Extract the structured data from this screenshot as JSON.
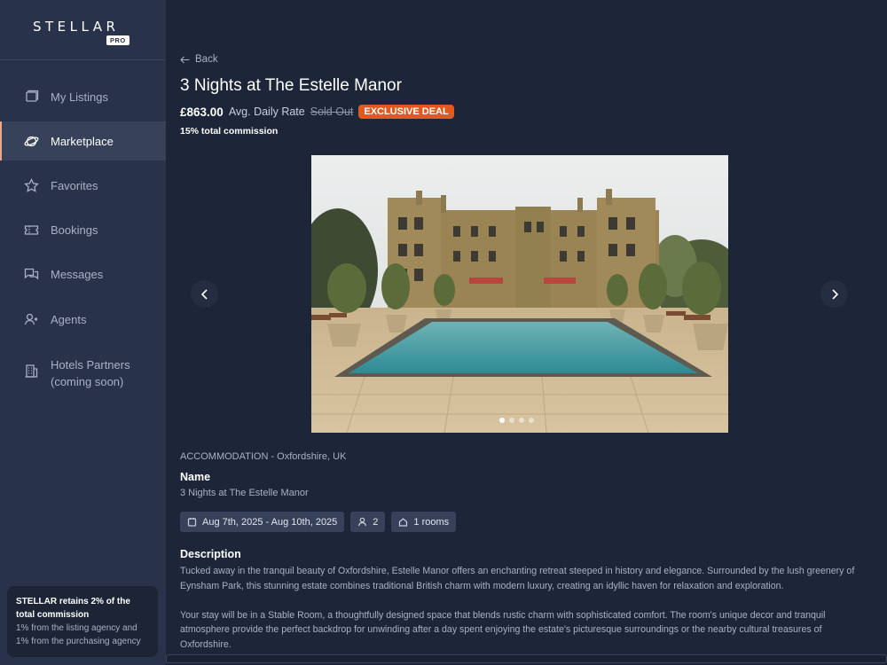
{
  "brand": {
    "name": "STELLAR",
    "badge": "PRO"
  },
  "sidebar": {
    "items": [
      {
        "label": "My Listings",
        "icon": "listings-icon"
      },
      {
        "label": "Marketplace",
        "icon": "planet-icon",
        "active": true
      },
      {
        "label": "Favorites",
        "icon": "star-icon"
      },
      {
        "label": "Bookings",
        "icon": "ticket-icon"
      },
      {
        "label": "Messages",
        "icon": "messages-icon"
      },
      {
        "label": "Agents",
        "icon": "add-user-icon"
      },
      {
        "label": "Hotels Partners (coming soon)",
        "icon": "building-icon"
      }
    ],
    "commission_note": {
      "bold": "STELLAR retains 2% of the total commission",
      "line1": "1% from the listing agency and",
      "line2": "1% from the purchasing agency"
    }
  },
  "listing": {
    "back_label": "Back",
    "title": "3 Nights at The Estelle Manor",
    "price": "£863.00",
    "rate_label": "Avg. Daily Rate",
    "status": "Sold Out",
    "deal_badge": "EXCLUSIVE DEAL",
    "commission": "15% total commission",
    "carousel": {
      "slides": 4,
      "current": 1
    },
    "category": "ACCOMMODATION - Oxfordshire, UK",
    "name_label": "Name",
    "name_value": "3 Nights at The Estelle Manor",
    "dates": "Aug 7th, 2025 - Aug 10th, 2025",
    "guests": "2",
    "rooms": "1 rooms",
    "description_label": "Description",
    "description_p1": "Tucked away in the tranquil beauty of Oxfordshire, Estelle Manor offers an enchanting retreat steeped in history and elegance. Surrounded by the lush greenery of Eynsham Park, this stunning estate combines traditional British charm with modern luxury, creating an idyllic haven for relaxation and exploration.",
    "description_p2": "Your stay will be in a Stable Room, a thoughtfully designed space that blends rustic charm with sophisticated comfort. The room's unique decor and tranquil atmosphere provide the perfect backdrop for unwinding after a day spent enjoying the estate's picturesque surroundings or the nearby cultural treasures of Oxfordshire."
  },
  "colors": {
    "accent": "#e0591e",
    "sidebar": "#28324a",
    "background": "#1d2538"
  }
}
